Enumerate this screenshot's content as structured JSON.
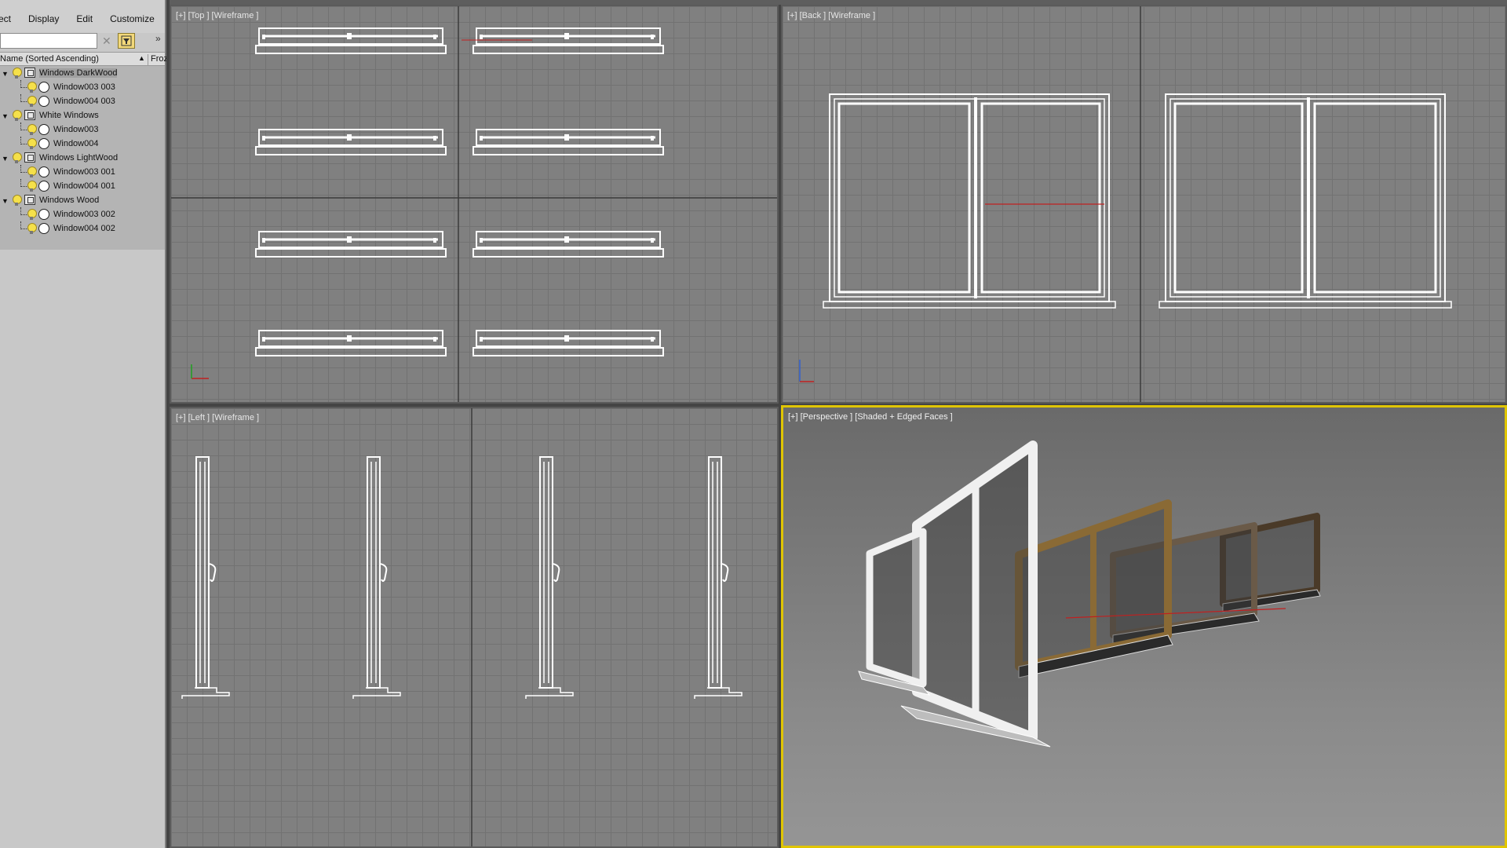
{
  "menu": [
    "ect",
    "Display",
    "Edit",
    "Customize"
  ],
  "toolbar": {
    "more": "»",
    "clear": "✕"
  },
  "columns": {
    "name": "Name (Sorted Ascending)",
    "sort_arrow": "▲",
    "frozen": "Froz"
  },
  "tree": [
    {
      "type": "layer",
      "label": "Windows DarkWood",
      "level": 0
    },
    {
      "type": "object",
      "label": "Window003 003",
      "level": 1
    },
    {
      "type": "object",
      "label": "Window004 003",
      "level": 1
    },
    {
      "type": "layer",
      "label": "White Windows",
      "level": 0
    },
    {
      "type": "object",
      "label": "Window003",
      "level": 1
    },
    {
      "type": "object",
      "label": "Window004",
      "level": 1
    },
    {
      "type": "layer",
      "label": "Windows LightWood",
      "level": 0
    },
    {
      "type": "object",
      "label": "Window003 001",
      "level": 1
    },
    {
      "type": "object",
      "label": "Window004 001",
      "level": 1
    },
    {
      "type": "layer",
      "label": "Windows Wood",
      "level": 0
    },
    {
      "type": "object",
      "label": "Window003 002",
      "level": 1
    },
    {
      "type": "object",
      "label": "Window004 002",
      "level": 1
    }
  ],
  "viewports": {
    "top": {
      "label": "[+] [Top ] [Wireframe ]"
    },
    "back": {
      "label": "[+] [Back ] [Wireframe ]"
    },
    "left": {
      "label": "[+] [Left ] [Wireframe ]"
    },
    "perspective": {
      "label": "[+] [Perspective ] [Shaded + Edged Faces ]"
    }
  },
  "colors": {
    "active_border": "#e0c500",
    "wire": "#ffffff",
    "grid_bg": "#808080",
    "lightwood": "#8a6a35",
    "darkwood": "#4a3a28"
  }
}
